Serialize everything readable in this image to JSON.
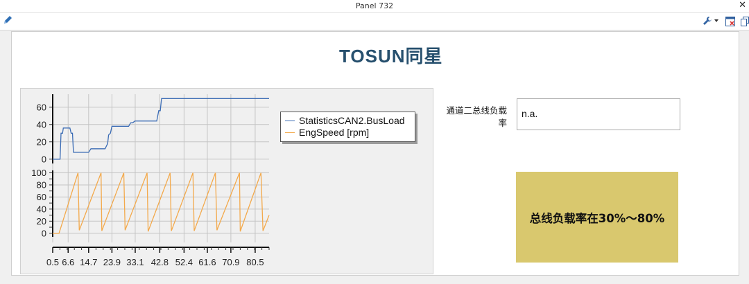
{
  "window": {
    "title": "Panel 732"
  },
  "toolbar": {
    "icons": [
      "pencil-icon",
      "wrench-icon",
      "window-close-icon",
      "window-copy-icon"
    ]
  },
  "logo": {
    "text": "TOSUN同星",
    "color": "#27506e"
  },
  "colors": {
    "busload": "#3b6cb5",
    "engspeed": "#f3a94b",
    "banner": "#d9c86e"
  },
  "legend": {
    "items": [
      "StatisticsCAN2.BusLoad",
      "EngSpeed [rpm]"
    ]
  },
  "chart_data": {
    "type": "line",
    "x_ticks": [
      "0.5",
      "6.6",
      "14.7",
      "23.9",
      "33.1",
      "42.8",
      "52.4",
      "61.6",
      "70.9",
      "80.5"
    ],
    "grid": true,
    "legend_position": "top-right",
    "series": [
      {
        "name": "StatisticsCAN2.BusLoad",
        "yticks": [
          0,
          20,
          40,
          60
        ],
        "ylim": [
          -5,
          75
        ],
        "points": [
          [
            0.5,
            0
          ],
          [
            3.4,
            0
          ],
          [
            3.8,
            30
          ],
          [
            4.4,
            30
          ],
          [
            4.7,
            36
          ],
          [
            6.4,
            36
          ],
          [
            7.3,
            36
          ],
          [
            7.8,
            30
          ],
          [
            8.3,
            30
          ],
          [
            8.7,
            8
          ],
          [
            9.6,
            8
          ],
          [
            14.7,
            8
          ],
          [
            15.6,
            12
          ],
          [
            21.2,
            12
          ],
          [
            22.2,
            18
          ],
          [
            22.6,
            28
          ],
          [
            23.3,
            30
          ],
          [
            23.9,
            38
          ],
          [
            30.5,
            38
          ],
          [
            31.3,
            42
          ],
          [
            32.1,
            42
          ],
          [
            33.0,
            44
          ],
          [
            41.6,
            44
          ],
          [
            42.4,
            56
          ],
          [
            43.0,
            56
          ],
          [
            43.5,
            70
          ],
          [
            52.4,
            70
          ],
          [
            70.9,
            70
          ],
          [
            86.0,
            70
          ]
        ]
      },
      {
        "name": "EngSpeed [rpm]",
        "yticks": [
          0,
          10,
          20,
          30,
          40,
          50,
          60,
          70,
          80,
          90,
          100
        ],
        "ylabels": [
          0,
          20,
          40,
          60,
          80,
          100
        ],
        "ylim": [
          -6,
          104
        ],
        "points": [
          [
            0.5,
            0
          ],
          [
            3.0,
            0
          ],
          [
            10.5,
            100
          ],
          [
            11.0,
            5
          ],
          [
            19.6,
            100
          ],
          [
            19.9,
            4
          ],
          [
            28.6,
            100
          ],
          [
            29.1,
            5
          ],
          [
            37.8,
            100
          ],
          [
            38.2,
            3
          ],
          [
            46.9,
            100
          ],
          [
            47.4,
            4
          ],
          [
            55.9,
            100
          ],
          [
            56.4,
            4
          ],
          [
            64.8,
            100
          ],
          [
            65.4,
            5
          ],
          [
            74.3,
            100
          ],
          [
            74.6,
            3
          ],
          [
            82.8,
            100
          ],
          [
            83.6,
            4
          ],
          [
            86.0,
            30
          ]
        ]
      }
    ]
  },
  "bus_load_field": {
    "label": "通道二总线负载率",
    "value": "n.a."
  },
  "banner": {
    "text": "总线负载率在30%～80%"
  }
}
